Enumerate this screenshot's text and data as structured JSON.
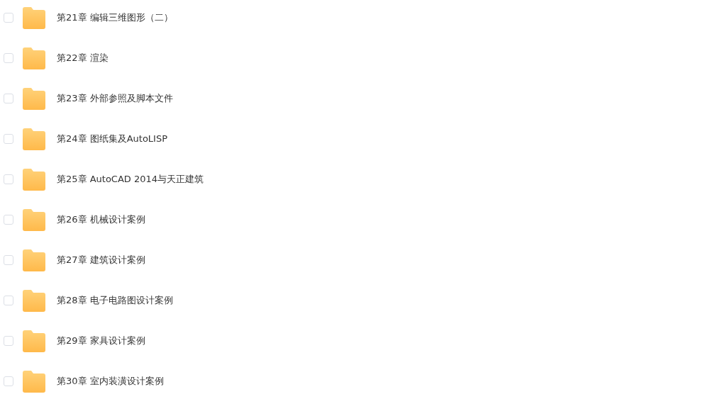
{
  "folders": [
    {
      "name": "第21章 编辑三维图形（二）",
      "checked": false
    },
    {
      "name": "第22章 渲染",
      "checked": false
    },
    {
      "name": "第23章 外部参照及脚本文件",
      "checked": false
    },
    {
      "name": "第24章 图纸集及AutoLISP",
      "checked": false
    },
    {
      "name": "第25章 AutoCAD 2014与天正建筑",
      "checked": false
    },
    {
      "name": "第26章 机械设计案例",
      "checked": false
    },
    {
      "name": "第27章 建筑设计案例",
      "checked": false
    },
    {
      "name": "第28章 电子电路图设计案例",
      "checked": false
    },
    {
      "name": "第29章 家具设计案例",
      "checked": false
    },
    {
      "name": "第30章 室内装潢设计案例",
      "checked": false
    }
  ]
}
